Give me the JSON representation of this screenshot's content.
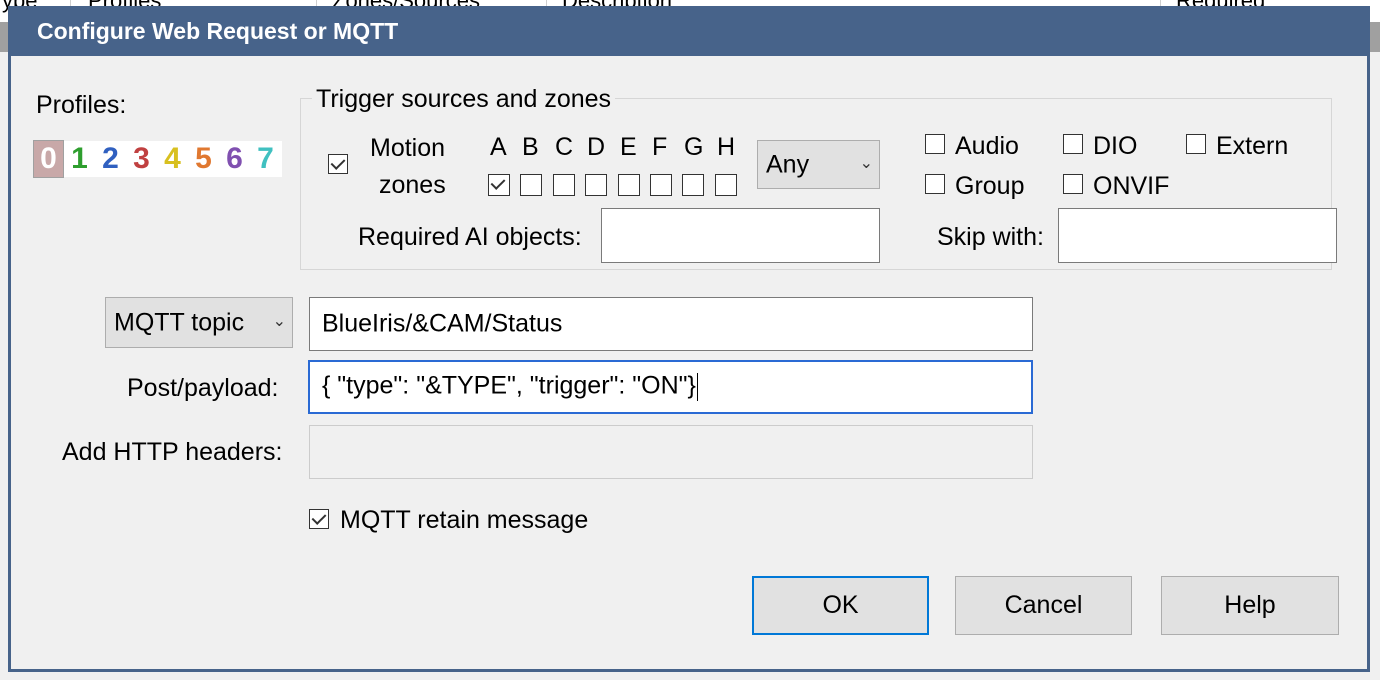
{
  "background": {
    "columns": [
      "ype",
      "Profiles",
      "Zones/Sources",
      "Description",
      "Required"
    ]
  },
  "dialog": {
    "title": "Configure Web Request or MQTT",
    "profiles": {
      "label": "Profiles:",
      "digits": [
        "0",
        "1",
        "2",
        "3",
        "4",
        "5",
        "6",
        "7"
      ],
      "colors": [
        "#ffffff",
        "#2e9e2e",
        "#3060c0",
        "#c04040",
        "#d8c020",
        "#e07830",
        "#8050b0",
        "#40c0c0"
      ],
      "selected": "0"
    },
    "trigger": {
      "group_title": "Trigger sources and zones",
      "motion_line1": "Motion",
      "motion_line2": "zones",
      "motion_checked": true,
      "zones": [
        "A",
        "B",
        "C",
        "D",
        "E",
        "F",
        "G",
        "H"
      ],
      "zones_checked": [
        "A"
      ],
      "any_value": "Any",
      "audio": "Audio",
      "dio": "DIO",
      "extern": "Extern",
      "group": "Group",
      "onvif": "ONVIF",
      "required_ai_label": "Required AI objects:",
      "required_ai_value": "",
      "skip_with_label": "Skip with:",
      "skip_with_value": ""
    },
    "request": {
      "type_value": "MQTT topic",
      "topic_value": "BlueIris/&CAM/Status",
      "payload_label": "Post/payload:",
      "payload_value": "{ \"type\": \"&TYPE\", \"trigger\": \"ON\"}",
      "headers_label": "Add HTTP headers:",
      "headers_value": "",
      "retain_label": "MQTT retain message",
      "retain_checked": true
    },
    "buttons": {
      "ok": "OK",
      "cancel": "Cancel",
      "help": "Help"
    }
  }
}
